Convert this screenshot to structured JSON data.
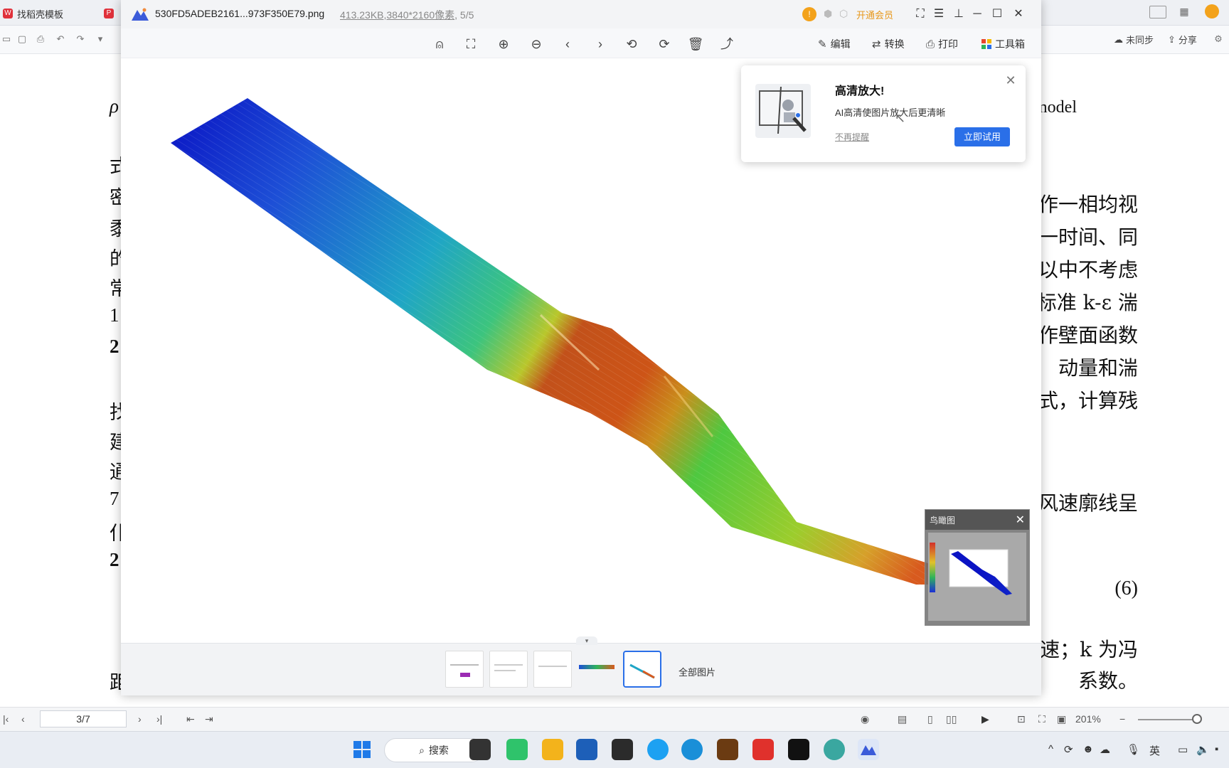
{
  "background_app": {
    "tabs": [
      {
        "label": "找稻壳模板"
      },
      {
        "label": ""
      }
    ],
    "right_tools": {
      "sync_label": "未同步",
      "share_label": "分享"
    },
    "document": {
      "left_chars": [
        "ρ",
        "式",
        "密",
        "黍",
        "的",
        "常",
        "1",
        "2",
        "找",
        "建",
        "通",
        "7",
        "仆",
        "2",
        "距"
      ],
      "right_lines": [
        "model",
        "作一相均视",
        "一时间、同",
        "以中不考虑",
        "标准 k-ε 湍",
        "作壁面函数",
        "动量和湍",
        "式，计算残",
        "风速廓线呈",
        "(6)",
        "速；k 为冯",
        "系数。"
      ]
    },
    "statusbar": {
      "page_indicator": "3/7",
      "zoom_label": "201%"
    }
  },
  "viewer": {
    "filename": "530FD5ADEB2161...973F350E79.png",
    "file_size": "413.23KB",
    "resolution": "3840*2160像素",
    "position": "5/5",
    "vip_label": "开通会员",
    "toolbar": {
      "edit_label": "编辑",
      "convert_label": "转换",
      "print_label": "打印",
      "toolbox_label": "工具箱"
    },
    "popup": {
      "title": "高清放大!",
      "description": "AI高清使图片放大后更清晰",
      "dismiss_label": "不再提醒",
      "cta_label": "立即试用"
    },
    "birdseye": {
      "title": "鸟瞰图"
    },
    "filmstrip": {
      "all_images_label": "全部图片"
    }
  },
  "taskbar": {
    "search_label": "搜索",
    "ime_label": "英"
  },
  "colors": {
    "accent": "#2a6fe8",
    "vip": "#e7971a"
  }
}
